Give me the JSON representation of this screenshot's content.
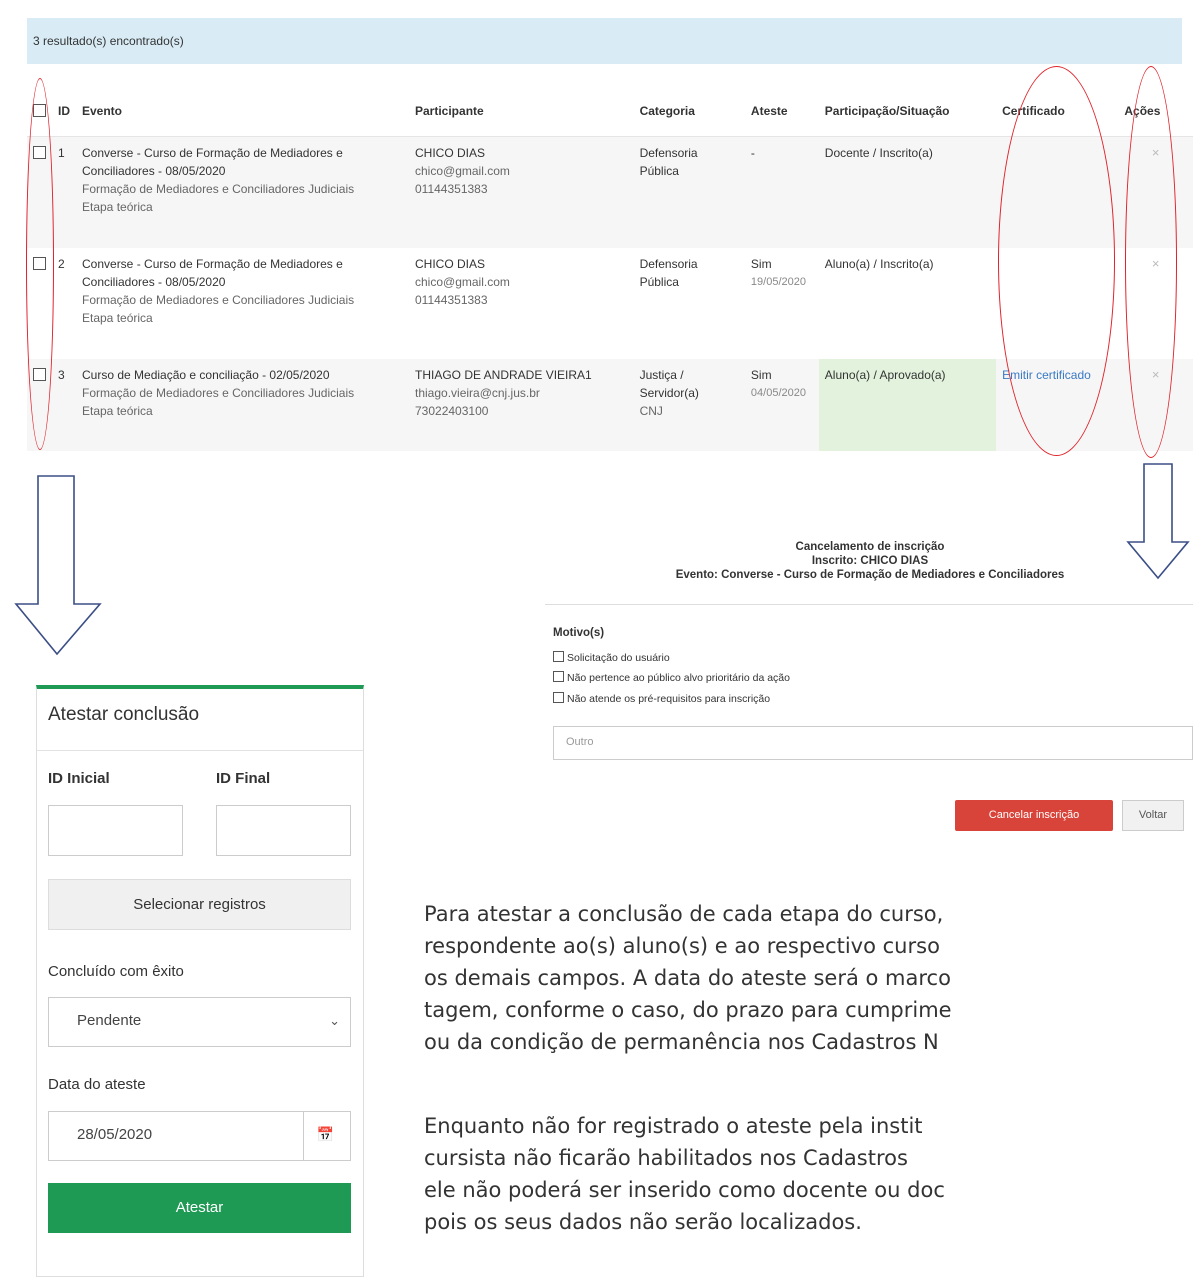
{
  "results": {
    "text": "3 resultado(s) encontrado(s)"
  },
  "table": {
    "headers": {
      "id": "ID",
      "evento": "Evento",
      "participante": "Participante",
      "categoria": "Categoria",
      "ateste": "Ateste",
      "participacao": "Participação/Situação",
      "certificado": "Certificado",
      "acoes": "Ações"
    },
    "rows": [
      {
        "id": "1",
        "evento": "Converse - Curso de Formação de Mediadores e Conciliadores - 08/05/2020",
        "formacao": "Formação de Mediadores e Conciliadores Judiciais",
        "etapa": "Etapa teórica",
        "nome": "CHICO DIAS",
        "email": "chico@gmail.com",
        "cpf": "01144351383",
        "categoria": "Defensoria Pública",
        "ateste": "-",
        "ateste_data": "",
        "situacao": "Docente / Inscrito(a)",
        "certificado": "",
        "acao": "×"
      },
      {
        "id": "2",
        "evento": "Converse - Curso de Formação de Mediadores e Conciliadores - 08/05/2020",
        "formacao": "Formação de Mediadores e Conciliadores Judiciais",
        "etapa": "Etapa teórica",
        "nome": "CHICO DIAS",
        "email": "chico@gmail.com",
        "cpf": "01144351383",
        "categoria": "Defensoria Pública",
        "ateste": "Sim",
        "ateste_data": "19/05/2020",
        "situacao": "Aluno(a) / Inscrito(a)",
        "certificado": "",
        "acao": "×"
      },
      {
        "id": "3",
        "evento": "Curso de Mediação e conciliação - 02/05/2020",
        "formacao": "Formação de Mediadores e Conciliadores Judiciais",
        "etapa": "Etapa teórica",
        "nome": "THIAGO DE ANDRADE VIEIRA1",
        "email": "thiago.vieira@cnj.jus.br",
        "cpf": "73022403100",
        "categoria": "Justiça / Servidor(a)",
        "categoria2": "CNJ",
        "ateste": "Sim",
        "ateste_data": "04/05/2020",
        "situacao": "Aluno(a) / Aprovado(a)",
        "certificado": "Emitir certificado",
        "acao": "×"
      }
    ]
  },
  "cancel_modal": {
    "title": "Cancelamento de inscrição",
    "inscrito": "Inscrito: CHICO DIAS",
    "evento": "Evento: Converse - Curso de Formação de Mediadores e Conciliadores",
    "motivo_label": "Motivo(s)",
    "options": [
      "Solicitação do usuário",
      "Não pertence ao público alvo prioritário da ação",
      "Não atende os pré-requisitos para inscrição"
    ],
    "outro_placeholder": "Outro",
    "cancel_button": "Cancelar inscrição",
    "back_button": "Voltar"
  },
  "atestar_panel": {
    "title": "Atestar conclusão",
    "id_inicial_label": "ID Inicial",
    "id_final_label": "ID Final",
    "select_button": "Selecionar registros",
    "concluido_label": "Concluído com êxito",
    "concluido_value": "Pendente",
    "data_label": "Data do ateste",
    "data_value": "28/05/2020",
    "submit_button": "Atestar"
  },
  "instructions": {
    "lines": [
      "Para atestar a conclusão de cada etapa do curso,",
      "respondente ao(s) aluno(s) e ao respectivo curso",
      "os demais campos. A data do ateste será o marco",
      "tagem, conforme o caso, do prazo para cumprime",
      "ou da condição de permanência nos Cadastros N",
      "Enquanto não for registrado o ateste pela instit",
      "cursista não ficarão habilitados nos Cadastros",
      "ele não poderá ser inserido como docente ou doc",
      "pois os seus dados não serão localizados."
    ]
  },
  "colors": {
    "accent_green": "#1e9a55",
    "danger_red": "#d9443a",
    "annotation_red": "#e0232b",
    "arrow_blue": "#3b4f86",
    "info_bg": "#d9ecf6"
  }
}
